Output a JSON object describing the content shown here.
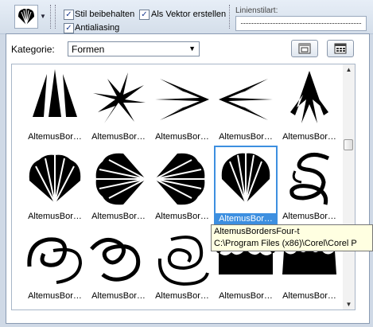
{
  "toolbar": {
    "shape_icon": "shell-shape-icon",
    "checkbox_stil": {
      "label": "Stil beibehalten",
      "checked": true
    },
    "checkbox_vektor": {
      "label": "Als Vektor erstellen",
      "checked": true
    },
    "checkbox_antialiasing": {
      "label": "Antialiasing",
      "checked": true
    },
    "linienstil_label": "Linienstilart:"
  },
  "panel": {
    "kategorie_label": "Kategorie:",
    "kategorie_value": "Formen",
    "folder_button_icon": "folder-icon",
    "grid_button_icon": "grid-view-icon"
  },
  "items": [
    {
      "caption": "AltemusBor…"
    },
    {
      "caption": "AltemusBor…"
    },
    {
      "caption": "AltemusBor…"
    },
    {
      "caption": "AltemusBor…"
    },
    {
      "caption": "AltemusBor…"
    },
    {
      "caption": "AltemusBor…"
    },
    {
      "caption": "AltemusBor…"
    },
    {
      "caption": "AltemusBor…"
    },
    {
      "caption": "AltemusBor…"
    },
    {
      "caption": "AltemusBor…"
    },
    {
      "caption": "AltemusBor…"
    },
    {
      "caption": "AltemusBor…"
    },
    {
      "caption": "AltemusBor…"
    },
    {
      "caption": "AltemusBor…"
    },
    {
      "caption": "AltemusBor…"
    }
  ],
  "tooltip": {
    "line1": "AltemusBordersFour-t",
    "line2": "C:\\Program Files (x86)\\Corel\\Corel P"
  },
  "colors": {
    "selection": "#3d8fe0",
    "tooltip_bg": "#ffffe1"
  }
}
